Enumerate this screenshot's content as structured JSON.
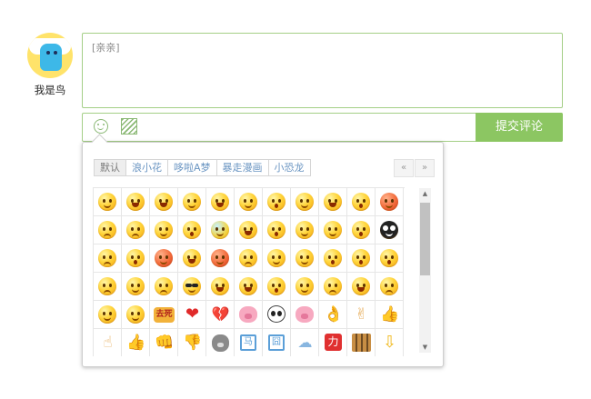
{
  "user": {
    "name": "我是鸟"
  },
  "comment": {
    "value": "[亲亲]"
  },
  "toolbar": {
    "emoji_icon": "smile-icon",
    "image_icon": "image-icon",
    "submit_label": "提交评论"
  },
  "emoji_panel": {
    "tabs": [
      {
        "label": "默认",
        "active": true
      },
      {
        "label": "浪小花",
        "active": false
      },
      {
        "label": "哆啦A梦",
        "active": false
      },
      {
        "label": "暴走漫画",
        "active": false
      },
      {
        "label": "小恐龙",
        "active": false
      }
    ],
    "pager": {
      "prev": "«",
      "next": "»"
    },
    "scroll": {
      "up": "▲",
      "down": "▼"
    },
    "rows": [
      [
        "smile",
        "laugh",
        "laugh",
        "smile",
        "laugh",
        "smile",
        "o",
        "smile",
        "laugh",
        "o",
        "angry"
      ],
      [
        "sad",
        "sad",
        "smile",
        "o",
        "blue",
        "laugh",
        "o",
        "smile",
        "smile",
        "o",
        "black"
      ],
      [
        "sad",
        "o",
        "angry",
        "laugh",
        "angry",
        "sad",
        "smile",
        "smile",
        "o",
        "o",
        "o"
      ],
      [
        "sad",
        "smile",
        "sad",
        "cool",
        "laugh",
        "laugh",
        "o",
        "smile",
        "sad",
        "laugh",
        "sad"
      ],
      [
        "smile",
        "smile",
        "text:去死",
        "heart",
        "broken",
        "pig",
        "panda",
        "pig",
        "hand",
        "hand",
        "hand"
      ],
      [
        "hand",
        "hand",
        "hand",
        "hand",
        "bear",
        "box:马",
        "box:囧",
        "cloud",
        "pow:力",
        "crowd",
        "arrow"
      ]
    ]
  },
  "icons": {
    "heart": "❤",
    "broken": "💔",
    "hand_ok": "👌",
    "hand_v": "✌",
    "hand_up": "👍",
    "hand_point": "☝",
    "hand_fist": "👊",
    "hand_down": "👎",
    "cloud": "☁",
    "arrow": "⇩"
  }
}
